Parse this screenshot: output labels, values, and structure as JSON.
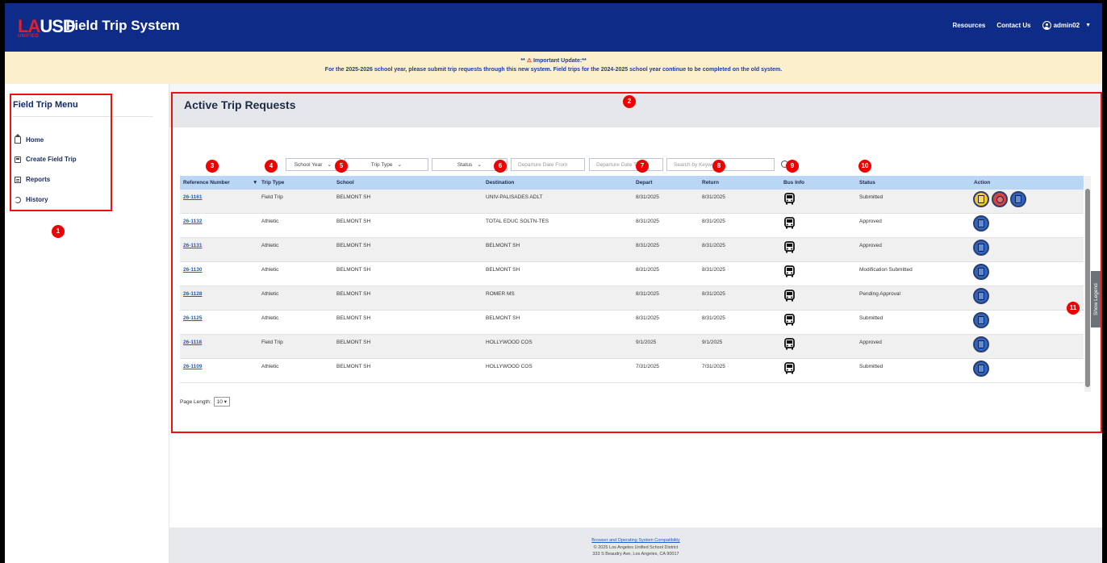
{
  "header": {
    "logo_la": "LA",
    "logo_usd": "USD",
    "logo_unified": "UNIFIED",
    "title": "Field Trip System",
    "resources": "Resources",
    "contact": "Contact Us",
    "user": "admin02"
  },
  "banner": {
    "line1": "Important Update:",
    "line2": "For the 2025-2026 school year, please submit trip requests through this new system. Field trips for the 2024-2025 school year continue to be completed on the old system."
  },
  "sidebar": {
    "title": "Field Trip Menu",
    "items": [
      {
        "label": "Home",
        "icon": "home-icon"
      },
      {
        "label": "Create Field Trip",
        "icon": "bus-icon"
      },
      {
        "label": "Reports",
        "icon": "report-icon"
      },
      {
        "label": "History",
        "icon": "history-icon"
      }
    ]
  },
  "main": {
    "title": "Active Trip Requests",
    "filters": {
      "school_year": "School Year",
      "trip_type": "Trip Type",
      "status": "Status",
      "date_from": "Departure Date From",
      "date_to": "Departure Date To",
      "keyword": "Search by Keyword"
    },
    "columns": [
      "Reference Number",
      "Trip Type",
      "School",
      "Destination",
      "Depart",
      "Return",
      "Bus Info",
      "Status",
      "Action"
    ],
    "rows": [
      {
        "ref": "26-1161",
        "type": "Field Trip",
        "school": "BELMONT SH",
        "dest": "UNIV-PALISADES ADLT",
        "depart": "8/31/2025",
        "return": "8/31/2025",
        "status": "Submitted",
        "actions": 3
      },
      {
        "ref": "26-1132",
        "type": "Athletic",
        "school": "BELMONT SH",
        "dest": "TOTAL EDUC SOLTN-TES",
        "depart": "8/31/2025",
        "return": "8/31/2025",
        "status": "Approved",
        "actions": 1
      },
      {
        "ref": "26-1131",
        "type": "Athletic",
        "school": "BELMONT SH",
        "dest": "BELMONT SH",
        "depart": "8/31/2025",
        "return": "8/31/2025",
        "status": "Approved",
        "actions": 1
      },
      {
        "ref": "26-1130",
        "type": "Athletic",
        "school": "BELMONT SH",
        "dest": "BELMONT SH",
        "depart": "8/31/2025",
        "return": "8/31/2025",
        "status": "Modification Submitted",
        "actions": 1
      },
      {
        "ref": "26-1128",
        "type": "Athletic",
        "school": "BELMONT SH",
        "dest": "ROMER MS",
        "depart": "8/31/2025",
        "return": "8/31/2025",
        "status": "Pending Approval",
        "actions": 1
      },
      {
        "ref": "26-1125",
        "type": "Athletic",
        "school": "BELMONT SH",
        "dest": "BELMONT SH",
        "depart": "8/31/2025",
        "return": "8/31/2025",
        "status": "Submitted",
        "actions": 1
      },
      {
        "ref": "26-1118",
        "type": "Field Trip",
        "school": "BELMONT SH",
        "dest": "HOLLYWOOD COS",
        "depart": "9/1/2025",
        "return": "9/1/2025",
        "status": "Approved",
        "actions": 1
      },
      {
        "ref": "26-1109",
        "type": "Athletic",
        "school": "BELMONT SH",
        "dest": "HOLLYWOOD COS",
        "depart": "7/31/2025",
        "return": "7/31/2025",
        "status": "Submitted",
        "actions": 1
      }
    ],
    "page_length_label": "Page Length:",
    "page_length": "10",
    "show_legend": "Show Legend"
  },
  "annotations": [
    "1",
    "2",
    "3",
    "4",
    "5",
    "6",
    "7",
    "8",
    "9",
    "10",
    "11"
  ],
  "footer": {
    "compat": "Browser and Operating System Compatibility",
    "copyright": "© 2025 Los Angeles Unified School District",
    "address": "333 S Beaudry Ave, Los Angeles, CA 90017"
  },
  "colors": {
    "header_bg": "#0d2b87",
    "banner_bg": "#fbf0cb",
    "table_head": "#b9d6f4",
    "annotation_red": "#e00000"
  }
}
